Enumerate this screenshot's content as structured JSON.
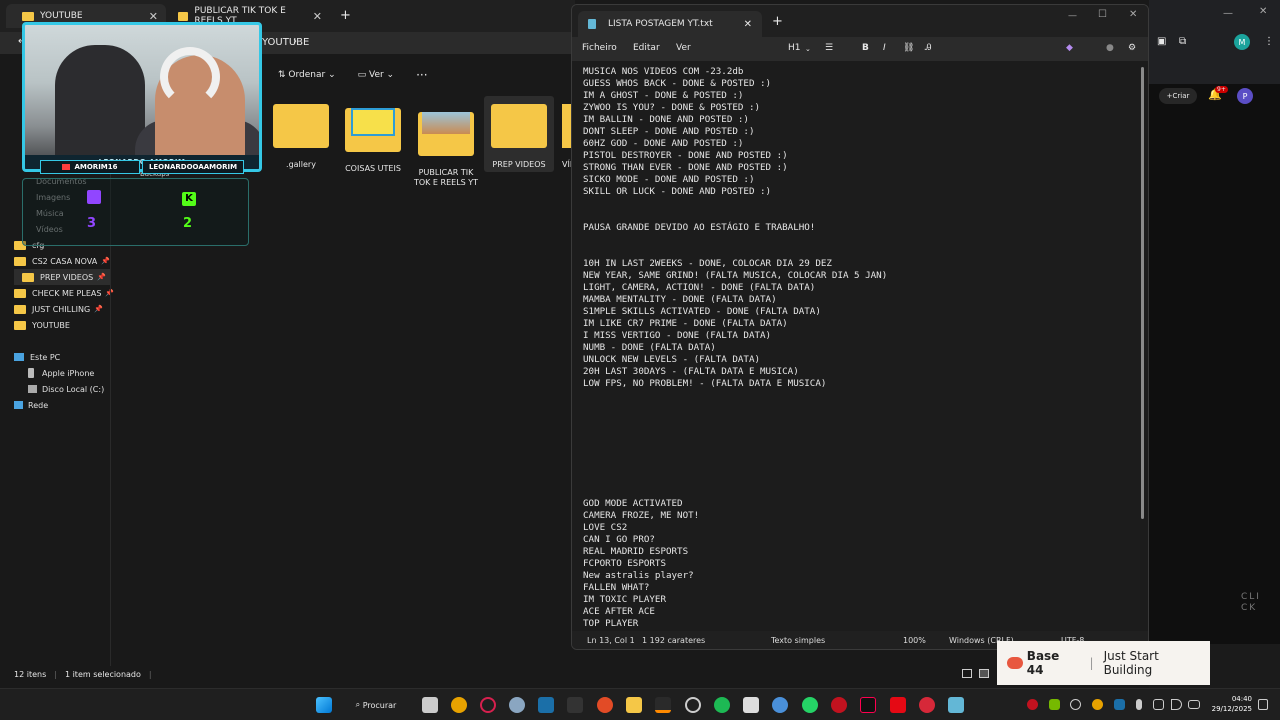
{
  "explorer": {
    "tabs": [
      {
        "label": "YOUTUBE"
      },
      {
        "label": "PUBLICAR TIK TOK E REELS YT"
      }
    ],
    "breadcrumb": "YOUTUBE",
    "toolbar": {
      "sort": "Ordenar",
      "view": "Ver",
      "more": "···"
    },
    "folders": [
      {
        "label": ".gallery"
      },
      {
        "label": "COISAS UTEIS"
      },
      {
        "label": "PUBLICAR TIK TOK E REELS YT"
      },
      {
        "label": "PREP VIDEOS"
      },
      {
        "label": "VÍD"
      }
    ],
    "partial_label": "Backups",
    "nav": [
      {
        "label": "Documentos"
      },
      {
        "label": "Imagens"
      },
      {
        "label": "Música"
      },
      {
        "label": "Vídeos"
      },
      {
        "label": "cfg"
      },
      {
        "label": "CS2 CASA NOVA"
      },
      {
        "label": "PREP VIDEOS"
      },
      {
        "label": "CHECK ME PLEAS"
      },
      {
        "label": "JUST CHILLING"
      },
      {
        "label": "YOUTUBE"
      },
      {
        "label": "Este PC"
      },
      {
        "label": "Apple iPhone"
      },
      {
        "label": "Disco Local (C:)"
      },
      {
        "label": "Rede"
      }
    ],
    "status": {
      "items": "12 itens",
      "selected": "1 item selecionado"
    }
  },
  "webcam": {
    "name": "LEONARDO AMORIM",
    "handles": [
      "AMORIM16",
      "LEONARDOOAAMORIM"
    ],
    "overlay_numbers": [
      "3",
      "2"
    ],
    "accent": "#35c8e6"
  },
  "notepad": {
    "tab_title": "LISTA POSTAGEM YT.txt",
    "menu": {
      "file": "Ficheiro",
      "edit": "Editar",
      "view": "Ver",
      "heading": "H1"
    },
    "content": "MUSICA NOS VIDEOS COM -23.2db\nGUESS WHOS BACK - DONE & POSTED :)\nIM A GHOST - DONE & POSTED :)\nZYWOO IS YOU? - DONE & POSTED :)\nIM BALLIN - DONE AND POSTED :)\nDONT SLEEP - DONE AND POSTED :)\n60HZ GOD - DONE AND POSTED :)\nPISTOL DESTROYER - DONE AND POSTED :)\nSTRONG THAN EVER - DONE AND POSTED :)\nSICKO MODE - DONE AND POSTED :)\nSKILL OR LUCK - DONE AND POSTED :)\n\n\nPAUSA GRANDE DEVIDO AO ESTÁGIO E TRABALHO!\n\n\n10H IN LAST 2WEEKS - DONE, COLOCAR DIA 29 DEZ\nNEW YEAR, SAME GRIND! (FALTA MUSICA, COLOCAR DIA 5 JAN)\nLIGHT, CAMERA, ACTION! - DONE (FALTA DATA)\nMAMBA MENTALITY - DONE (FALTA DATA)\nS1MPLE SKILLS ACTIVATED - DONE (FALTA DATA)\nIM LIKE CR7 PRIME - DONE (FALTA DATA)\nI MISS VERTIGO - DONE (FALTA DATA)\nNUMB - DONE (FALTA DATA)\nUNLOCK NEW LEVELS - (FALTA DATA)\n20H LAST 30DAYS - (FALTA DATA E MUSICA)\nLOW FPS, NO PROBLEM! - (FALTA DATA E MUSICA)\n\n\n\n\n\n\n\n\n\nGOD MODE ACTIVATED\nCAMERA FROZE, ME NOT!\nLOVE CS2\nCAN I GO PRO?\nREAL MADRID ESPORTS\nFCPORTO ESPORTS\nNew astralis player?\nFALLEN WHAT?\nIM TOXIC PLAYER\nACE AFTER ACE\nTOP PLAYER",
    "status": {
      "position": "Ln 13, Col 1",
      "chars": "1 192 carateres",
      "format": "Texto simples",
      "zoom": "100%",
      "eol": "Windows (CRLF)",
      "encoding": "UTF-8"
    }
  },
  "rightapp": {
    "create": "Criar",
    "notifications": "9+",
    "avatar": "P",
    "profile": "M",
    "watermark": "CLI\nCK"
  },
  "ad": {
    "brand": "Base 44",
    "tagline": "Just Start Building"
  },
  "taskbar": {
    "search": "Procurar",
    "time": "04:40",
    "date": "29/12/2025"
  }
}
